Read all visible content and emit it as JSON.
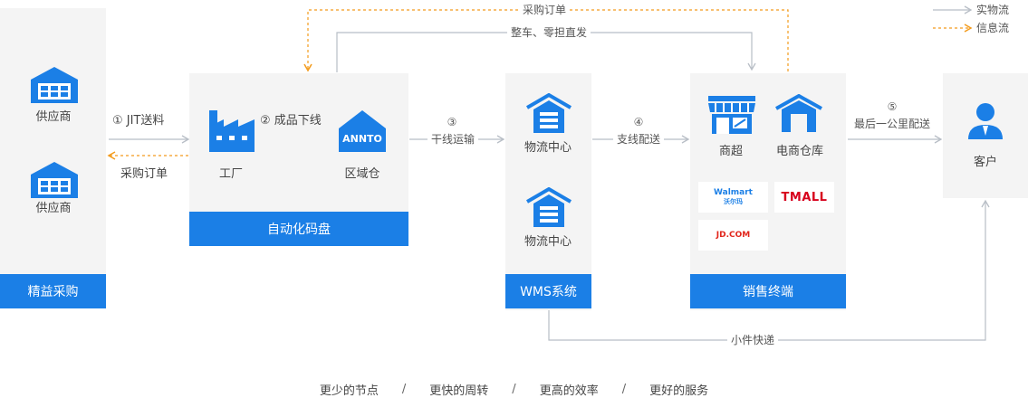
{
  "panels": {
    "procurement": {
      "label": "精益采购"
    },
    "auto_count": {
      "label": "自动化码盘"
    },
    "wms": {
      "label": "WMS系统"
    },
    "sales": {
      "label": "销售终端"
    }
  },
  "nodes": {
    "supplier_1": "供应商",
    "supplier_2": "供应商",
    "factory": "工厂",
    "regional_warehouse": "区域仓",
    "logistics_center_1": "物流中心",
    "logistics_center_2": "物流中心",
    "supermarket": "商超",
    "ecommerce_warehouse": "电商仓库",
    "customer": "客户"
  },
  "edges": {
    "jit": "① JIT送料",
    "purchase_order_back": "采购订单",
    "finished_goods": "② 成品下线",
    "trunk_step": "③",
    "trunk_text": "干线运输",
    "branch_step": "④",
    "branch_text": "支线配送",
    "last_mile_step": "⑤",
    "last_mile_text": "最后一公里配送",
    "top_purchase_order": "采购订单",
    "top_direct": "整车、零担直发",
    "small_express": "小件快递"
  },
  "legend": {
    "physical": "实物流",
    "info": "信息流"
  },
  "logos": {
    "annto": "ANNTO",
    "walmart": "Walmart",
    "walmart_cn": "沃尔玛",
    "tmall": "TMALL",
    "jd": "JD.COM"
  },
  "footer": {
    "items": [
      "更少的节点",
      "更快的周转",
      "更高的效率",
      "更好的服务"
    ],
    "separator": "/"
  },
  "colors": {
    "primary": "#1b7fe6",
    "panel": "#f4f4f4",
    "physical_flow": "#b8bec6",
    "info_flow": "#f39b1c",
    "tmall_red": "#d7001c",
    "jd_red": "#e1251b"
  }
}
